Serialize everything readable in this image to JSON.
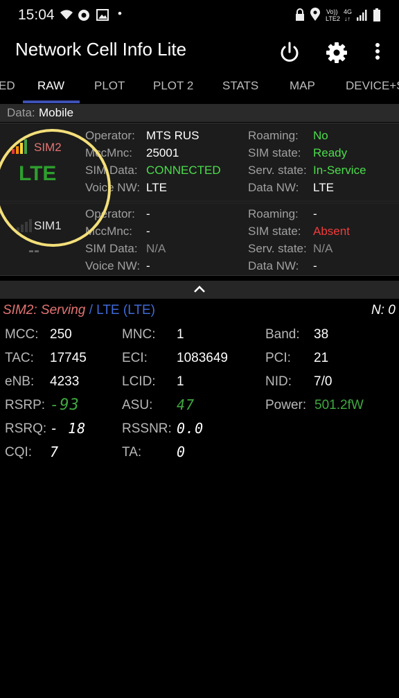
{
  "status_bar": {
    "time": "15:04",
    "volte_top": "Vo))",
    "volte_bottom": "LTE2",
    "net_top": "4G",
    "net_bottom": "↓↑"
  },
  "app": {
    "title": "Network Cell Info Lite"
  },
  "tabs": [
    "ED",
    "RAW",
    "PLOT",
    "PLOT 2",
    "STATS",
    "MAP",
    "DEVICE+S"
  ],
  "data_row": {
    "label": "Data:",
    "value": "Mobile"
  },
  "sim2": {
    "name": "SIM2",
    "tech": "LTE",
    "operator_k": "Operator:",
    "operator": "MTS RUS",
    "mccmnc_k": "MccMnc:",
    "mccmnc": "25001",
    "simdata_k": "SIM Data:",
    "simdata": "CONNECTED",
    "voice_k": "Voice NW:",
    "voice": "LTE",
    "roaming_k": "Roaming:",
    "roaming": "No",
    "simstate_k": "SIM state:",
    "simstate": "Ready",
    "serv_k": "Serv. state:",
    "serv": "In-Service",
    "datanw_k": "Data NW:",
    "datanw": "LTE"
  },
  "sim1": {
    "name": "SIM1",
    "tech": "--",
    "operator_k": "Operator:",
    "operator": "-",
    "mccmnc_k": "MccMnc:",
    "mccmnc": "-",
    "simdata_k": "SIM Data:",
    "simdata": "N/A",
    "voice_k": "Voice NW:",
    "voice": "-",
    "roaming_k": "Roaming:",
    "roaming": "-",
    "simstate_k": "SIM state:",
    "simstate": "Absent",
    "serv_k": "Serv. state:",
    "serv": "N/A",
    "datanw_k": "Data NW:",
    "datanw": "-"
  },
  "serving": {
    "sim": "SIM2: Serving",
    "slash": "/",
    "tech": "LTE (LTE)",
    "neighbors": "N: 0"
  },
  "cell": {
    "mcc_k": "MCC:",
    "mcc": "250",
    "mnc_k": "MNC:",
    "mnc": "1",
    "band_k": "Band:",
    "band": "38",
    "tac_k": "TAC:",
    "tac": "17745",
    "eci_k": "ECI:",
    "eci": "1083649",
    "pci_k": "PCI:",
    "pci": "21",
    "enb_k": "eNB:",
    "enb": "4233",
    "lcid_k": "LCID:",
    "lcid": "1",
    "nid_k": "NID:",
    "nid": "7/0",
    "rsrp_k": "RSRP:",
    "rsrp": "-93",
    "asu_k": "ASU:",
    "asu": "47",
    "power_k": "Power:",
    "power": "501.2fW",
    "rsrq_k": "RSRQ:",
    "rsrq": "- 18",
    "rssnr_k": "RSSNR:",
    "rssnr": "0.0",
    "cqi_k": "CQI:",
    "cqi": "7",
    "ta_k": "TA:",
    "ta": "0"
  },
  "colors": {
    "accent": "#3f51b5",
    "good": "#4cdc4c",
    "bad": "#f03b3b",
    "sim2_label": "#e57373",
    "tech_blue": "#3f6ad8",
    "annotation": "#f3df7a"
  }
}
